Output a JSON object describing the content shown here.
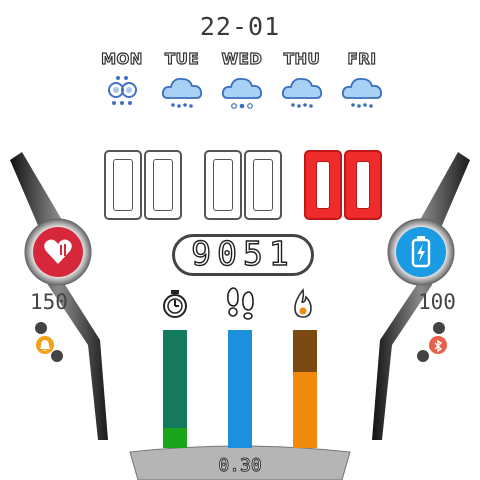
{
  "date": "22-01",
  "forecast": [
    {
      "day": "MON",
      "icon": "snowflake-weather-icon"
    },
    {
      "day": "TUE",
      "icon": "cloud-rain-icon"
    },
    {
      "day": "WED",
      "icon": "cloud-rain-icon"
    },
    {
      "day": "THU",
      "icon": "cloud-rain-icon"
    },
    {
      "day": "FRI",
      "icon": "cloud-rain-icon"
    }
  ],
  "time": {
    "hours": "00",
    "minutes": "00",
    "seconds": "00"
  },
  "steps": "9051",
  "heart_rate": "150",
  "battery": "100",
  "distance": "0.30",
  "bars": [
    {
      "name": "timer",
      "icon": "timer-icon",
      "fill_fraction": 0.17,
      "color_top": "#137a5c",
      "color_bottom": "#1aa51a"
    },
    {
      "name": "steps",
      "icon": "footprints-icon",
      "fill_fraction": 1.0,
      "color": "#1b90dd"
    },
    {
      "name": "calories",
      "icon": "flame-icon",
      "fill_fraction": 0.64,
      "color_top": "#7a4a12",
      "color_bottom": "#f28a0e"
    }
  ],
  "colors": {
    "accent_red": "#ef2b2b",
    "heart": "#d6283a",
    "battery": "#1a9be3"
  }
}
